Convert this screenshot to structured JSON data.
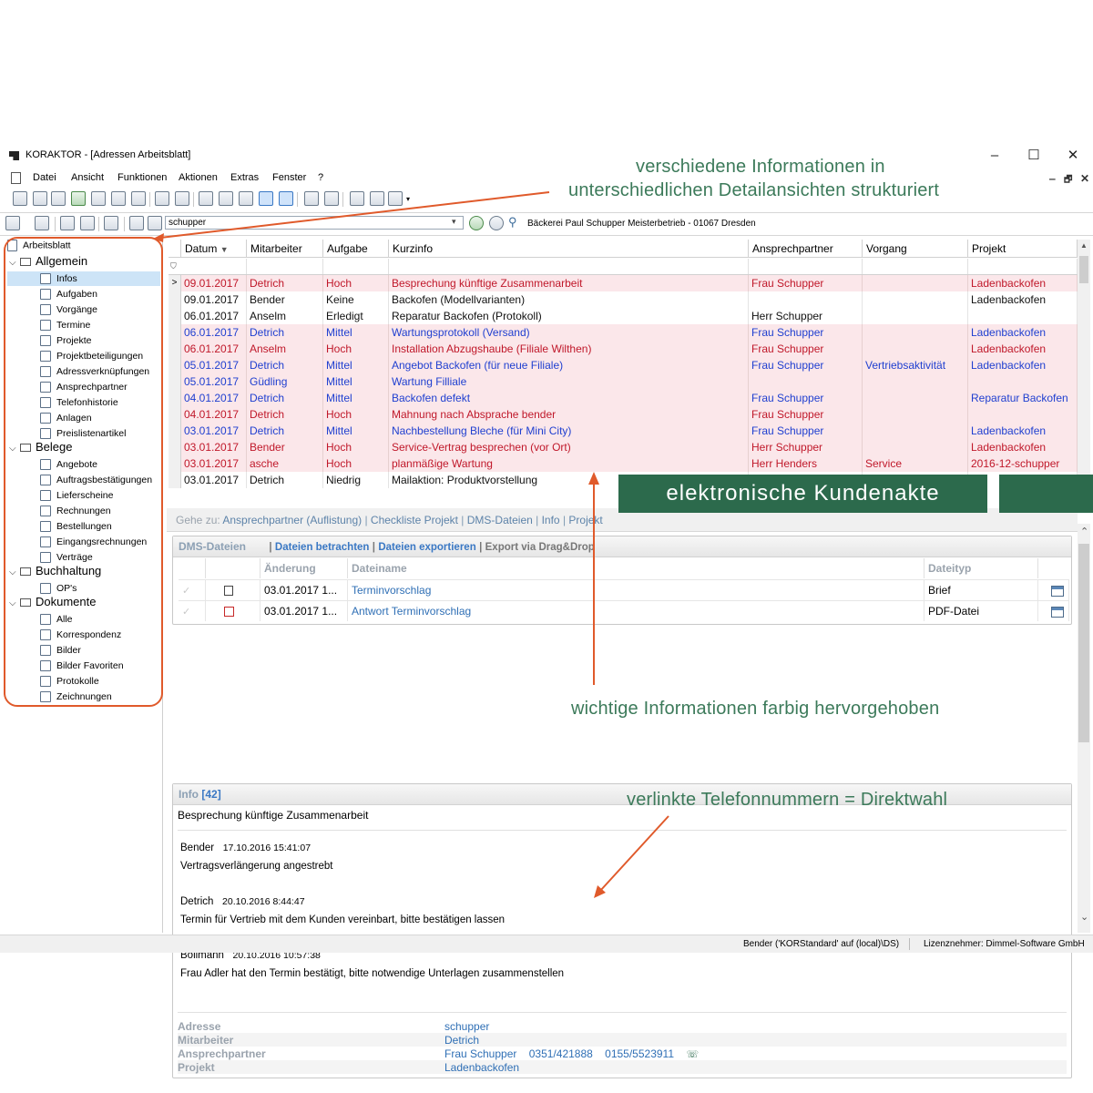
{
  "window": {
    "title": "KORAKTOR - [Adressen Arbeitsblatt]",
    "minimize": "–",
    "maximize": "☐",
    "close": "✕",
    "mdi_minimize": "‒",
    "mdi_restore": "🗗",
    "mdi_close": "✕"
  },
  "menu": [
    "Datei",
    "Ansicht",
    "Funktionen",
    "Aktionen",
    "Extras",
    "Fenster",
    "?"
  ],
  "search": {
    "value": "schupper",
    "address_title": "Bäckerei Paul Schupper Meisterbetrieb - 01067 Dresden"
  },
  "tree": {
    "root": "Arbeitsblatt",
    "groups": [
      {
        "label": "Allgemein",
        "items": [
          "Infos",
          "Aufgaben",
          "Vorgänge",
          "Termine",
          "Projekte",
          "Projektbeteiligungen",
          "Adressverknüpfungen",
          "Ansprechpartner",
          "Telefonhistorie",
          "Anlagen",
          "Preislistenartikel"
        ]
      },
      {
        "label": "Belege",
        "items": [
          "Angebote",
          "Auftragsbestätigungen",
          "Lieferscheine",
          "Rechnungen",
          "Bestellungen",
          "Eingangsrechnungen",
          "Verträge"
        ]
      },
      {
        "label": "Buchhaltung",
        "items": [
          "OP's"
        ]
      },
      {
        "label": "Dokumente",
        "items": [
          "Alle",
          "Korrespondenz",
          "Bilder",
          "Bilder Favoriten",
          "Protokolle",
          "Zeichnungen"
        ]
      }
    ],
    "selected": "Infos"
  },
  "grid": {
    "columns": [
      "Datum",
      "Mitarbeiter",
      "Aufgabe",
      "Kurzinfo",
      "Ansprechpartner",
      "Vorgang",
      "Projekt"
    ],
    "sort_indicator": "▼",
    "rows": [
      {
        "datum": "09.01.2017",
        "mitarbeiter": "Detrich",
        "aufgabe": "Hoch",
        "kurzinfo": "Besprechung künftige Zusammenarbeit",
        "ansprechpartner": "Frau Schupper",
        "vorgang": "",
        "projekt": "Ladenbackofen",
        "color": "#c0182a",
        "bg": "pink",
        "current": true
      },
      {
        "datum": "09.01.2017",
        "mitarbeiter": "Bender",
        "aufgabe": "Keine",
        "kurzinfo": "Backofen (Modellvarianten)",
        "ansprechpartner": "",
        "vorgang": "",
        "projekt": "Ladenbackofen",
        "color": "#111111",
        "bg": "white"
      },
      {
        "datum": "06.01.2017",
        "mitarbeiter": "Anselm",
        "aufgabe": "Erledigt",
        "kurzinfo": "Reparatur Backofen (Protokoll)",
        "ansprechpartner": "Herr Schupper",
        "vorgang": "",
        "projekt": "",
        "color": "#111111",
        "bg": "white"
      },
      {
        "datum": "06.01.2017",
        "mitarbeiter": "Detrich",
        "aufgabe": "Mittel",
        "kurzinfo": "Wartungsprotokoll (Versand)",
        "ansprechpartner": "Frau Schupper",
        "vorgang": "",
        "projekt": "Ladenbackofen",
        "color": "#1f3fd0",
        "bg": "pink"
      },
      {
        "datum": "06.01.2017",
        "mitarbeiter": "Anselm",
        "aufgabe": "Hoch",
        "kurzinfo": "Installation Abzugshaube (Filiale Wilthen)",
        "ansprechpartner": "Frau Schupper",
        "vorgang": "",
        "projekt": "Ladenbackofen",
        "color": "#c0182a",
        "bg": "pink"
      },
      {
        "datum": "05.01.2017",
        "mitarbeiter": "Detrich",
        "aufgabe": "Mittel",
        "kurzinfo": "Angebot Backofen (für neue Filiale)",
        "ansprechpartner": "Frau Schupper",
        "vorgang": "Vertriebsaktivität",
        "projekt": "Ladenbackofen",
        "color": "#1f3fd0",
        "bg": "pink"
      },
      {
        "datum": "05.01.2017",
        "mitarbeiter": "Güdling",
        "aufgabe": "Mittel",
        "kurzinfo": "Wartung Filliale",
        "ansprechpartner": "",
        "vorgang": "",
        "projekt": "",
        "color": "#1f3fd0",
        "bg": "pink"
      },
      {
        "datum": "04.01.2017",
        "mitarbeiter": "Detrich",
        "aufgabe": "Mittel",
        "kurzinfo": "Backofen defekt",
        "ansprechpartner": "Frau Schupper",
        "vorgang": "",
        "projekt": "Reparatur Backofen",
        "color": "#1f3fd0",
        "bg": "pink"
      },
      {
        "datum": "04.01.2017",
        "mitarbeiter": "Detrich",
        "aufgabe": "Hoch",
        "kurzinfo": "Mahnung nach Absprache bender",
        "ansprechpartner": "Frau Schupper",
        "vorgang": "",
        "projekt": "",
        "color": "#c0182a",
        "bg": "pink"
      },
      {
        "datum": "03.01.2017",
        "mitarbeiter": "Detrich",
        "aufgabe": "Mittel",
        "kurzinfo": "Nachbestellung Bleche (für Mini City)",
        "ansprechpartner": "Frau Schupper",
        "vorgang": "",
        "projekt": "Ladenbackofen",
        "color": "#1f3fd0",
        "bg": "pink"
      },
      {
        "datum": "03.01.2017",
        "mitarbeiter": "Bender",
        "aufgabe": "Hoch",
        "kurzinfo": "Service-Vertrag besprechen (vor Ort)",
        "ansprechpartner": "Herr Schupper",
        "vorgang": "",
        "projekt": "Ladenbackofen",
        "color": "#c0182a",
        "bg": "pink"
      },
      {
        "datum": "03.01.2017",
        "mitarbeiter": "asche",
        "aufgabe": "Hoch",
        "kurzinfo": "planmäßige Wartung",
        "ansprechpartner": "Herr Henders",
        "vorgang": "Service",
        "projekt": "2016-12-schupper",
        "color": "#c0182a",
        "bg": "pink"
      },
      {
        "datum": "03.01.2017",
        "mitarbeiter": "Detrich",
        "aufgabe": "Niedrig",
        "kurzinfo": "Mailaktion: Produktvorstellung",
        "ansprechpartner": "",
        "vorgang": "",
        "projekt": "",
        "color": "#111111",
        "bg": "white"
      }
    ]
  },
  "goto": {
    "prefix": "Gehe zu:",
    "links": [
      "Ansprechpartner (Auflistung)",
      "Checkliste Projekt",
      "DMS-Dateien",
      "Info",
      "Projekt"
    ]
  },
  "dms": {
    "title": "DMS-Dateien",
    "actions": [
      "Dateien betrachten",
      "Dateien exportieren",
      "Export via Drag&Drop"
    ],
    "columns": [
      "Änderung",
      "Dateiname",
      "Dateityp"
    ],
    "files": [
      {
        "changed": "03.01.2017 1...",
        "name": "Terminvorschlag",
        "type": "Brief",
        "icon": "word-icon"
      },
      {
        "changed": "03.01.2017 1...",
        "name": "Antwort Terminvorschlag",
        "type": "PDF-Datei",
        "icon": "pdf-icon"
      }
    ]
  },
  "info": {
    "title": "Info",
    "count": "[42]",
    "subject": "Besprechung künftige Zusammenarbeit",
    "entries": [
      {
        "author": "Bender",
        "timestamp": "17.10.2016 15:41:07",
        "text": "Vertragsverlängerung angestrebt"
      },
      {
        "author": "Detrich",
        "timestamp": "20.10.2016 8:44:47",
        "text": "Termin für Vertrieb mit dem Kunden vereinbart, bitte bestätigen lassen"
      },
      {
        "author": "Bollmann",
        "timestamp": "20.10.2016 10:57:38",
        "text": "Frau Adler hat den Termin bestätigt, bitte notwendige Unterlagen zusammenstellen"
      }
    ],
    "fields": [
      {
        "label": "Adresse",
        "value": "schupper"
      },
      {
        "label": "Mitarbeiter",
        "value": "Detrich"
      },
      {
        "label": "Ansprechpartner",
        "value": "Frau Schupper",
        "phone1": "0351/421888",
        "phone2": "0155/5523911"
      },
      {
        "label": "Projekt",
        "value": "Ladenbackofen"
      }
    ]
  },
  "status": {
    "user": "Bender ('KORStandard' auf (local)\\DS)",
    "licensee": "Lizenznehmer: Dimmel-Software GmbH"
  },
  "annotations": {
    "top": "verschiedene Informationen in",
    "top2": "unterschiedlichen Detailansichten strukturiert",
    "banner": "elektronische Kundenakte",
    "highlight": "wichtige Informationen farbig hervorgehoben",
    "phone": "verlinkte Telefonnummern = Direktwahl"
  },
  "colors": {
    "annotation": "#3c7a5a",
    "arrow": "#e05a2b",
    "banner": "#2c6a4c",
    "link": "#2f6fb5"
  }
}
